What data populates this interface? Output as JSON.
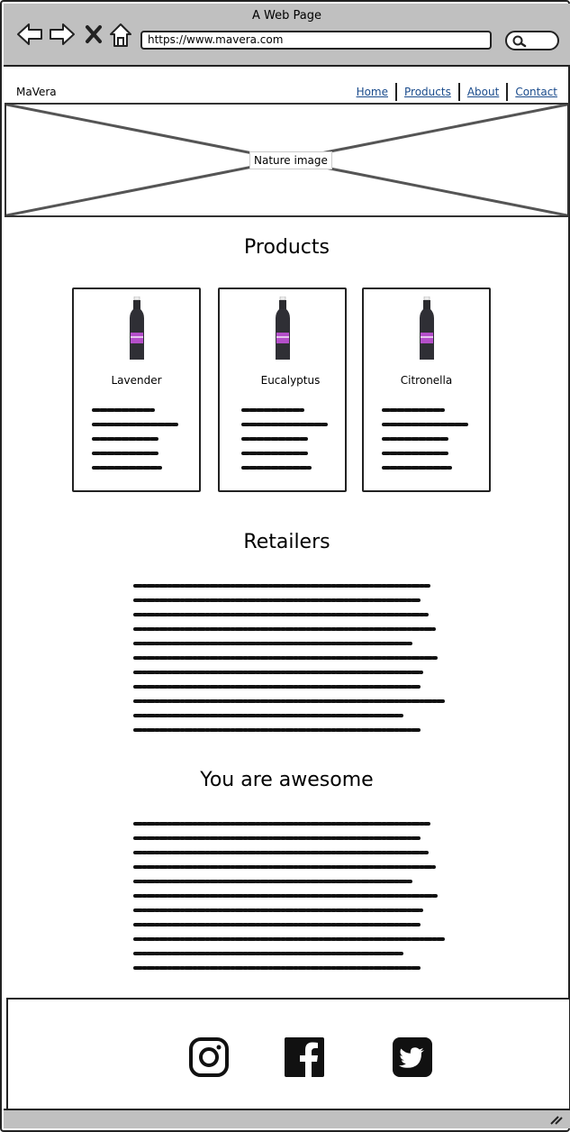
{
  "browser": {
    "window_title": "A Web Page",
    "url": "https://www.mavera.com"
  },
  "site": {
    "logo": "MaVera",
    "nav": [
      "Home",
      "Products",
      "About",
      "Contact"
    ]
  },
  "hero": {
    "label": "Nature image"
  },
  "products": {
    "title": "Products",
    "items": [
      {
        "name": "Lavender"
      },
      {
        "name": "Eucalyptus"
      },
      {
        "name": "Citronella"
      }
    ]
  },
  "retailers": {
    "title": "Retailers"
  },
  "awesome": {
    "title": "You are awesome"
  },
  "footer": {
    "social": [
      "instagram-icon",
      "facebook-icon",
      "twitter-icon"
    ]
  },
  "colors": {
    "chrome": "#c0c0c0",
    "link": "#1a4b8c",
    "bottle_label": "#b44fc9"
  }
}
